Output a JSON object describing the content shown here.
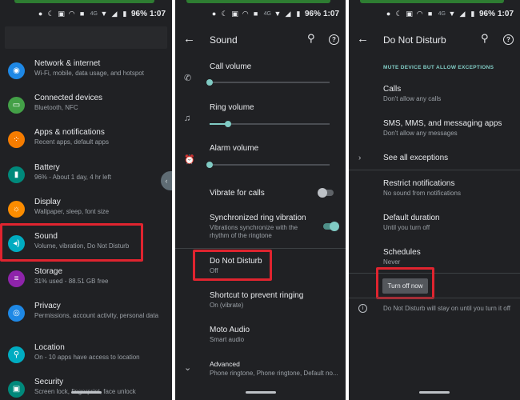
{
  "status_bar": {
    "signal_label": "4G",
    "battery": "96%",
    "time": "1:07"
  },
  "settings": {
    "items": [
      {
        "title": "Network & internet",
        "subtitle": "Wi-Fi, mobile, data usage, and hotspot",
        "icon": "wifi-icon",
        "color": "#1e88e5"
      },
      {
        "title": "Connected devices",
        "subtitle": "Bluetooth, NFC",
        "icon": "devices-icon",
        "color": "#43a047"
      },
      {
        "title": "Apps & notifications",
        "subtitle": "Recent apps, default apps",
        "icon": "apps-icon",
        "color": "#f57c00"
      },
      {
        "title": "Battery",
        "subtitle": "96% - About 1 day, 4 hr left",
        "icon": "battery-icon",
        "color": "#00897b"
      },
      {
        "title": "Display",
        "subtitle": "Wallpaper, sleep, font size",
        "icon": "display-icon",
        "color": "#fb8c00"
      },
      {
        "title": "Sound",
        "subtitle": "Volume, vibration, Do Not Disturb",
        "icon": "volume-icon",
        "color": "#00acc1"
      },
      {
        "title": "Storage",
        "subtitle": "31% used - 88.51 GB free",
        "icon": "storage-icon",
        "color": "#8e24aa"
      },
      {
        "title": "Privacy",
        "subtitle": "Permissions, account activity, personal data",
        "icon": "privacy-eye-icon",
        "color": "#1e88e5"
      },
      {
        "title": "Location",
        "subtitle": "On - 10 apps have access to location",
        "icon": "location-pin-icon",
        "color": "#00acc1"
      },
      {
        "title": "Security",
        "subtitle": "Screen lock, fingerprint, face unlock",
        "icon": "lock-icon",
        "color": "#00897b"
      }
    ]
  },
  "sound": {
    "title": "Sound",
    "call_volume": {
      "label": "Call volume",
      "level": 0
    },
    "ring_volume": {
      "label": "Ring volume",
      "level": 0.15
    },
    "alarm_volume": {
      "label": "Alarm volume",
      "level": 0
    },
    "vibrate_for_calls": {
      "label": "Vibrate for calls",
      "on": false
    },
    "sync_vibration": {
      "label": "Synchronized ring vibration",
      "subtitle": "Vibrations synchronize with the rhythm of the ringtone",
      "on": true
    },
    "dnd": {
      "title": "Do Not Disturb",
      "subtitle": "Off"
    },
    "shortcut": {
      "title": "Shortcut to prevent ringing",
      "subtitle": "On (vibrate)"
    },
    "moto_audio": {
      "title": "Moto Audio",
      "subtitle": "Smart audio"
    },
    "advanced": {
      "title": "Advanced",
      "subtitle": "Phone ringtone, Phone ringtone, Default no..."
    }
  },
  "dnd": {
    "title": "Do Not Disturb",
    "section_label": "MUTE DEVICE BUT ALLOW EXCEPTIONS",
    "calls": {
      "title": "Calls",
      "subtitle": "Don't allow any calls"
    },
    "messages": {
      "title": "SMS, MMS, and messaging apps",
      "subtitle": "Don't allow any messages"
    },
    "see_all": "See all exceptions",
    "restrict": {
      "title": "Restrict notifications",
      "subtitle": "No sound from notifications"
    },
    "duration": {
      "title": "Default duration",
      "subtitle": "Until you turn off"
    },
    "schedules": {
      "title": "Schedules",
      "subtitle": "Never"
    },
    "turn_off_button": "Turn off now",
    "info_text": "Do Not Disturb will stay on until you turn it off"
  },
  "colors": {
    "accent": "#80cbc4",
    "highlight": "#e0242f",
    "background": "#202124"
  }
}
